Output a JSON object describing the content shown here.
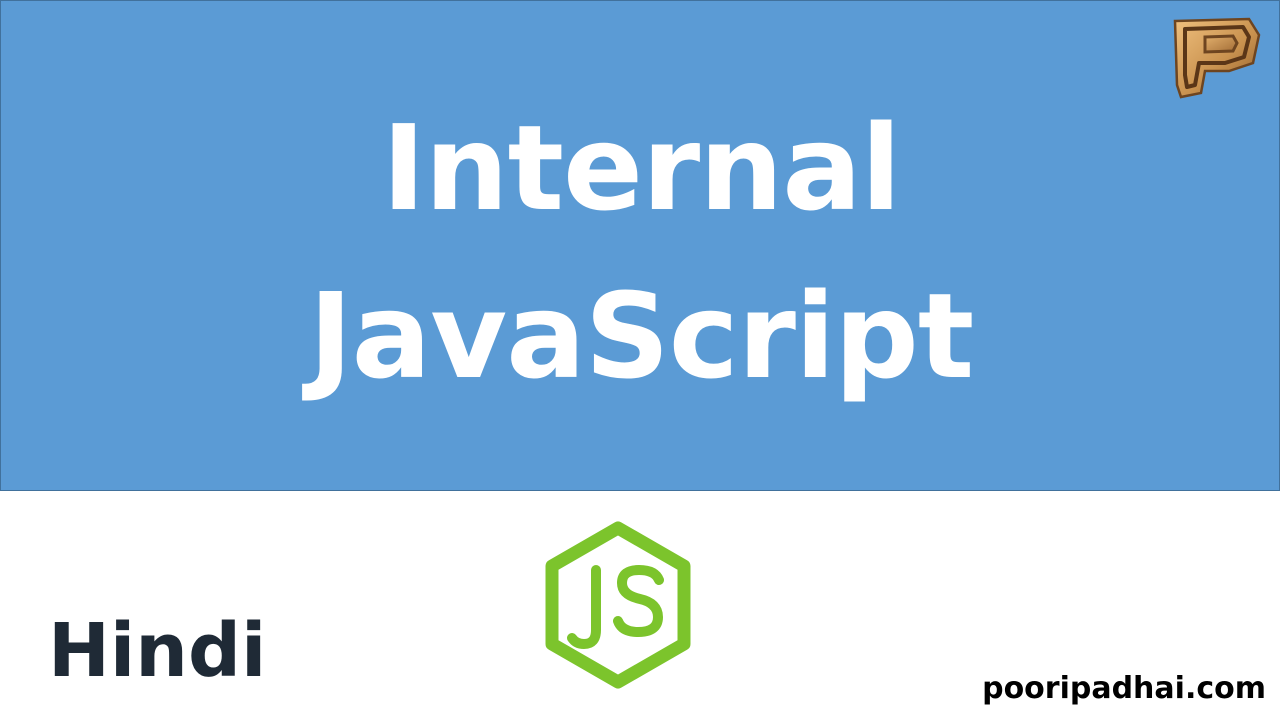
{
  "slide": {
    "title_line_1": "Internal",
    "title_line_2": "JavaScript",
    "language_label": "Hindi",
    "website": "pooripadhai.com"
  },
  "icons": {
    "brand": "poori-padhai-p-logo-icon",
    "js": "javascript-hexagon-logo-icon"
  },
  "colors": {
    "banner": "#5b9bd5",
    "banner_border": "#41719c",
    "title_text": "#ffffff",
    "language_text": "#1f2a36",
    "website_text": "#000000",
    "js_logo_green": "#7cc42c",
    "brand_logo_gold": "#c9924f"
  }
}
